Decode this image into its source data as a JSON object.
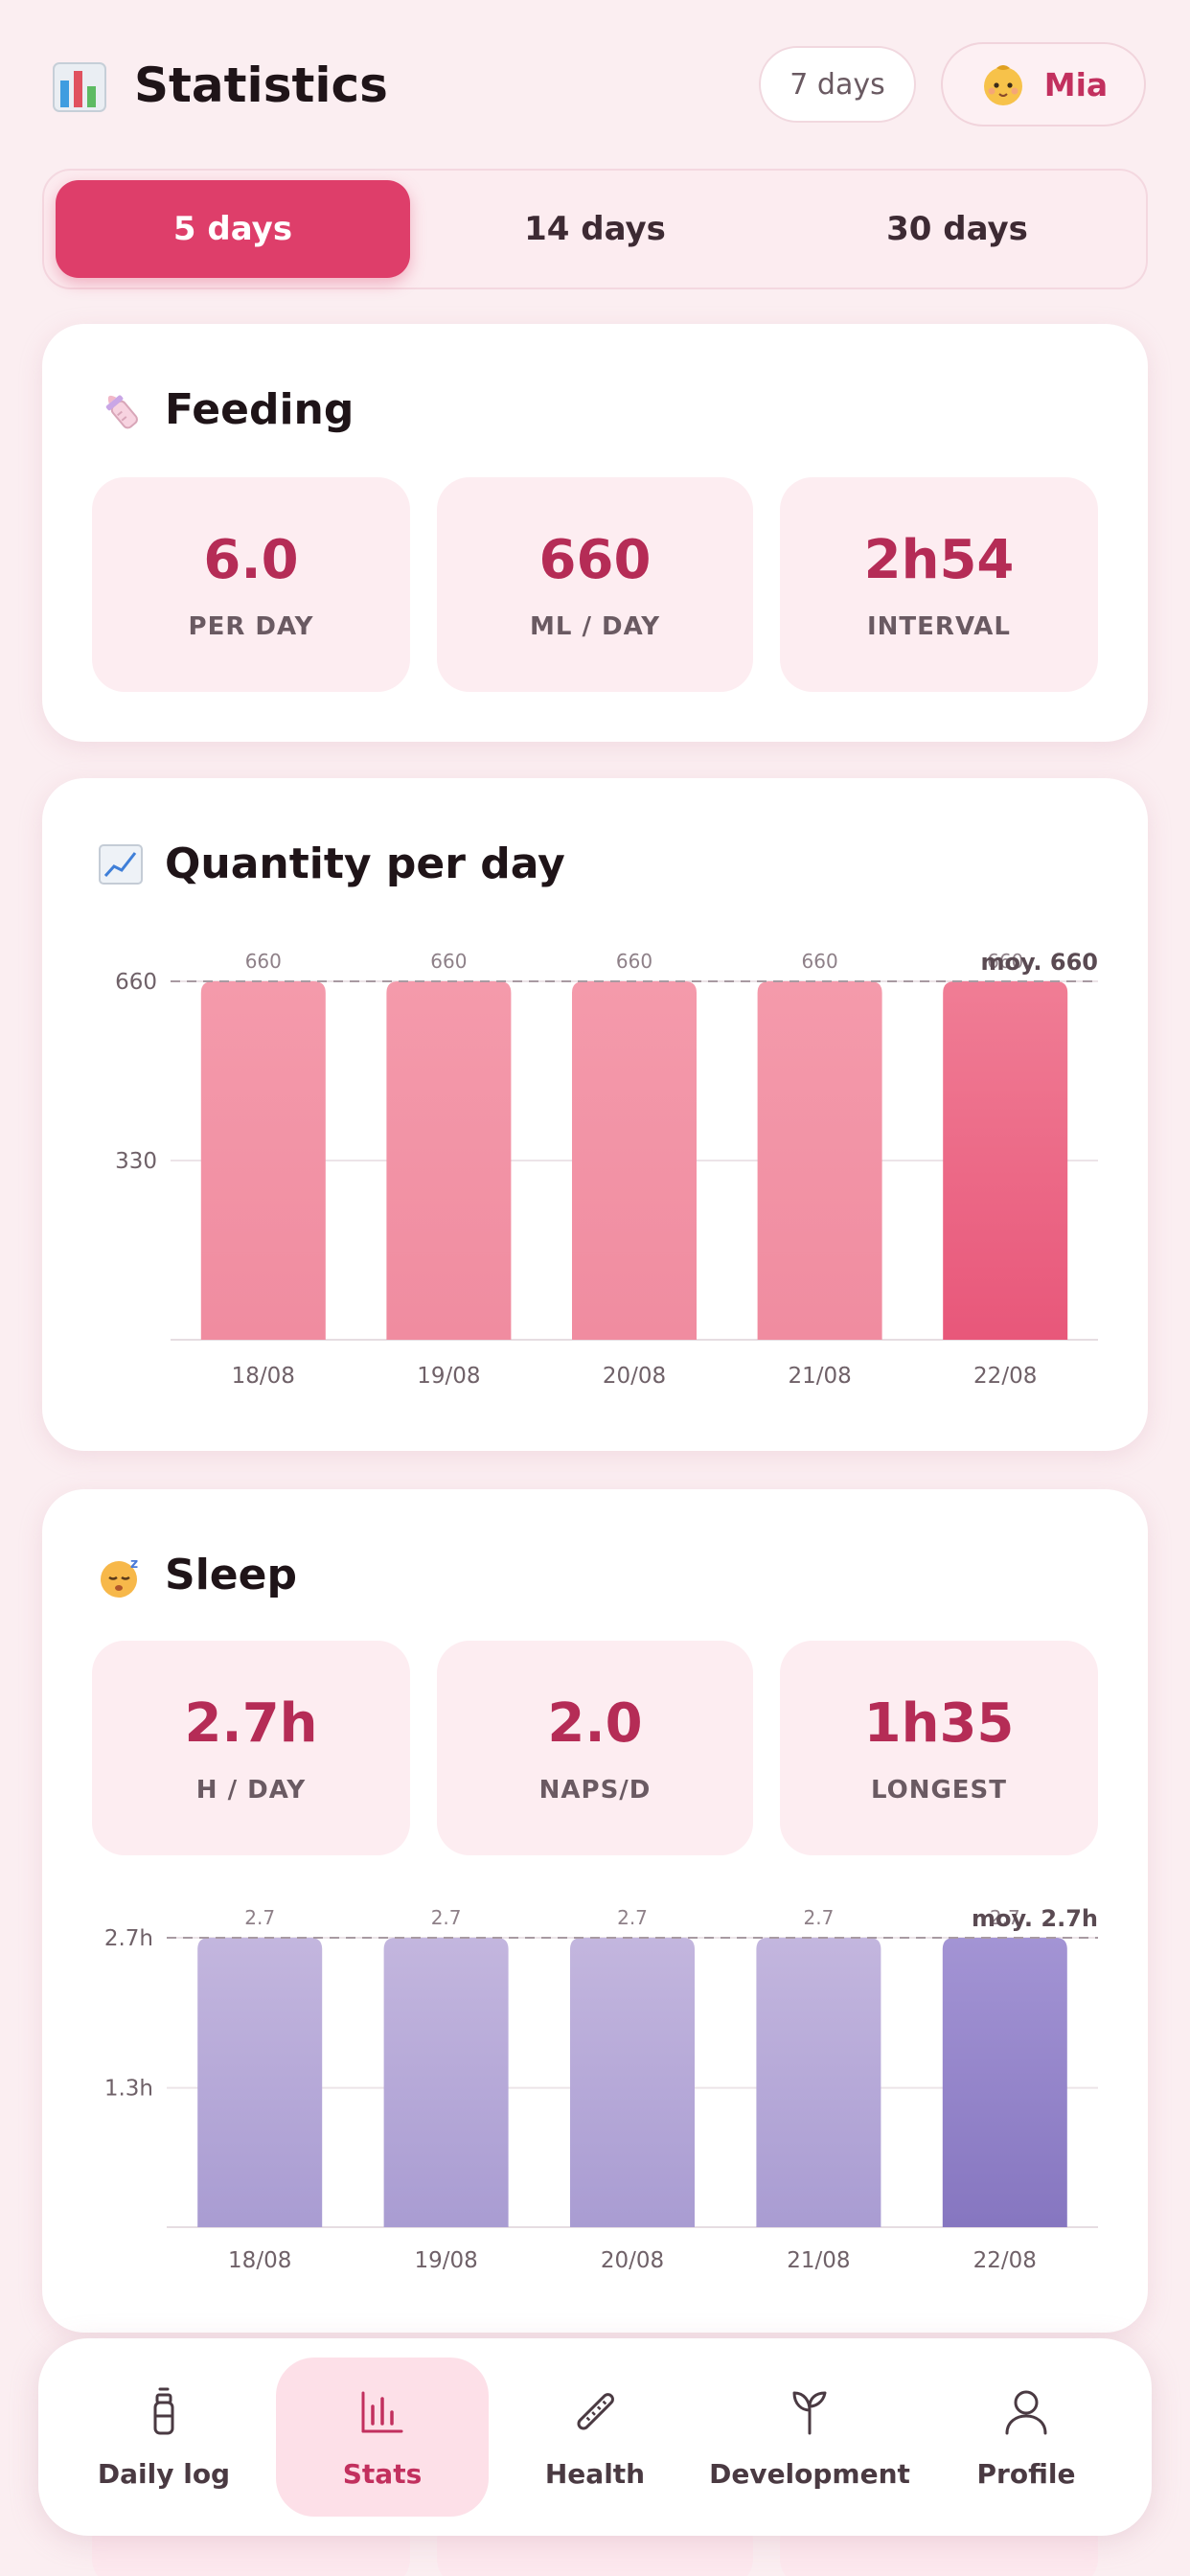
{
  "header": {
    "title": "Statistics",
    "range_pill": "7 days",
    "profile_name": "Mia"
  },
  "segments": [
    {
      "label": "5 days",
      "active": true
    },
    {
      "label": "14 days",
      "active": false
    },
    {
      "label": "30 days",
      "active": false
    }
  ],
  "feeding": {
    "title": "Feeding",
    "stats": [
      {
        "value": "6.0",
        "label": "PER DAY"
      },
      {
        "value": "660",
        "label": "ML / DAY"
      },
      {
        "value": "2h54",
        "label": "INTERVAL"
      }
    ]
  },
  "quantity": {
    "title": "Quantity per day"
  },
  "sleep": {
    "title": "Sleep",
    "stats": [
      {
        "value": "2.7h",
        "label": "H / DAY"
      },
      {
        "value": "2.0",
        "label": "NAPS/D"
      },
      {
        "value": "1h35",
        "label": "LONGEST"
      }
    ]
  },
  "chart_data": [
    {
      "type": "bar",
      "title": "Quantity per day",
      "categories": [
        "18/08",
        "19/08",
        "20/08",
        "21/08",
        "22/08"
      ],
      "values": [
        660,
        660,
        660,
        660,
        660
      ],
      "value_labels": [
        "660",
        "660",
        "660",
        "660",
        "660"
      ],
      "y_ticks": [
        330,
        660
      ],
      "y_tick_labels": [
        "330",
        "660"
      ],
      "ylim": [
        0,
        660
      ],
      "average_label": "moy. 660",
      "average_value": 660,
      "highlight_index": 4,
      "colors": {
        "bar": "#f49aab",
        "bar_bottom": "#f08ca0",
        "highlight": "#f07d95",
        "highlight_bottom": "#e8577a"
      },
      "grid": true
    },
    {
      "type": "bar",
      "title": "",
      "categories": [
        "18/08",
        "19/08",
        "20/08",
        "21/08",
        "22/08"
      ],
      "values": [
        2.7,
        2.7,
        2.7,
        2.7,
        2.7
      ],
      "value_labels": [
        "2.7",
        "2.7",
        "2.7",
        "2.7",
        "2.7"
      ],
      "y_ticks": [
        1.3,
        2.7
      ],
      "y_tick_labels": [
        "1.3h",
        "2.7h"
      ],
      "ylim": [
        0,
        2.7
      ],
      "average_label": "moy. 2.7h",
      "average_value": 2.7,
      "highlight_index": 4,
      "colors": {
        "bar": "#c3b6de",
        "bar_bottom": "#a99cd2",
        "highlight": "#a394d4",
        "highlight_bottom": "#8676c0"
      },
      "grid": true
    }
  ],
  "nav": [
    {
      "label": "Daily log",
      "icon": "bottle-icon",
      "active": false
    },
    {
      "label": "Stats",
      "icon": "bar-chart-icon",
      "active": true
    },
    {
      "label": "Health",
      "icon": "thermometer-icon",
      "active": false
    },
    {
      "label": "Development",
      "icon": "sprout-icon",
      "active": false
    },
    {
      "label": "Profile",
      "icon": "person-icon",
      "active": false
    }
  ],
  "colors": {
    "accent": "#de3e6a",
    "value_text": "#b52c56",
    "background": "#fbeef1"
  }
}
